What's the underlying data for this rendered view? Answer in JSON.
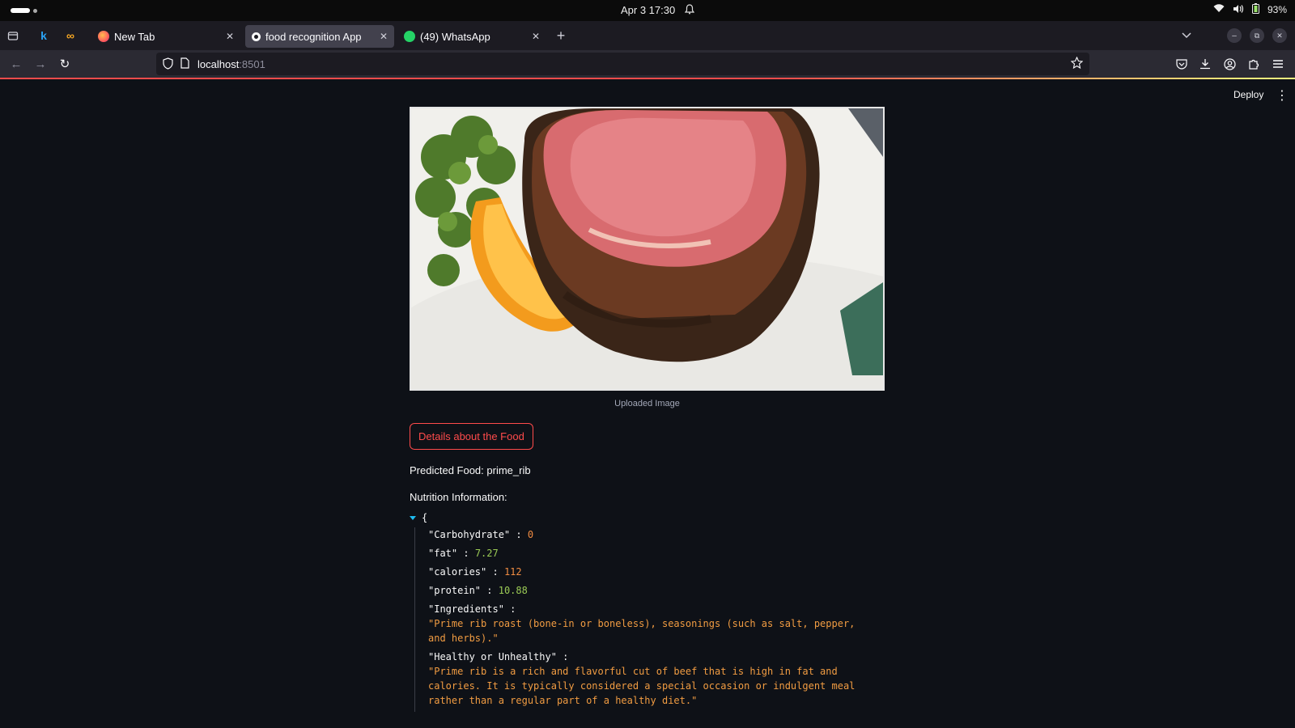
{
  "os": {
    "clock": "Apr 3  17:30",
    "battery": "93%"
  },
  "browser": {
    "tabs": [
      {
        "label": "New Tab",
        "favicon": "firefox-icon",
        "active": false
      },
      {
        "label": "food recognition App",
        "favicon": "streamlit-icon",
        "active": true
      },
      {
        "label": "(49) WhatsApp",
        "favicon": "whatsapp-icon",
        "active": false
      }
    ],
    "url_host": "localhost",
    "url_port": ":8501"
  },
  "app": {
    "deploy_label": "Deploy",
    "image_caption": "Uploaded Image",
    "details_button": "Details about the Food",
    "predicted_food": "Predicted Food: prime_rib",
    "nutrition_heading": "Nutrition Information:",
    "json": {
      "open_brace": "{",
      "carbohydrate_key": "\"Carbohydrate\"",
      "carbohydrate_val": "0",
      "fat_key": "\"fat\"",
      "fat_val": "7.27",
      "calories_key": "\"calories\"",
      "calories_val": "112",
      "protein_key": "\"protein\"",
      "protein_val": "10.88",
      "ingredients_key": "\"Ingredients\"",
      "ingredients_val": "\"Prime rib roast (bone-in or boneless), seasonings (such as salt, pepper, and herbs).\"",
      "healthy_key": "\"Healthy or Unhealthy\"",
      "healthy_val": "\"Prime rib is a rich and flavorful cut of beef that is high in fat and calories. It is typically considered a special occasion or indulgent meal rather than a regular part of a healthy diet.\""
    }
  },
  "colors": {
    "accent": "#ff4b4b",
    "background": "#0e1117",
    "json_number": "#f18c42",
    "json_number_decimal": "#9bcb55",
    "json_string": "#f19c42"
  }
}
